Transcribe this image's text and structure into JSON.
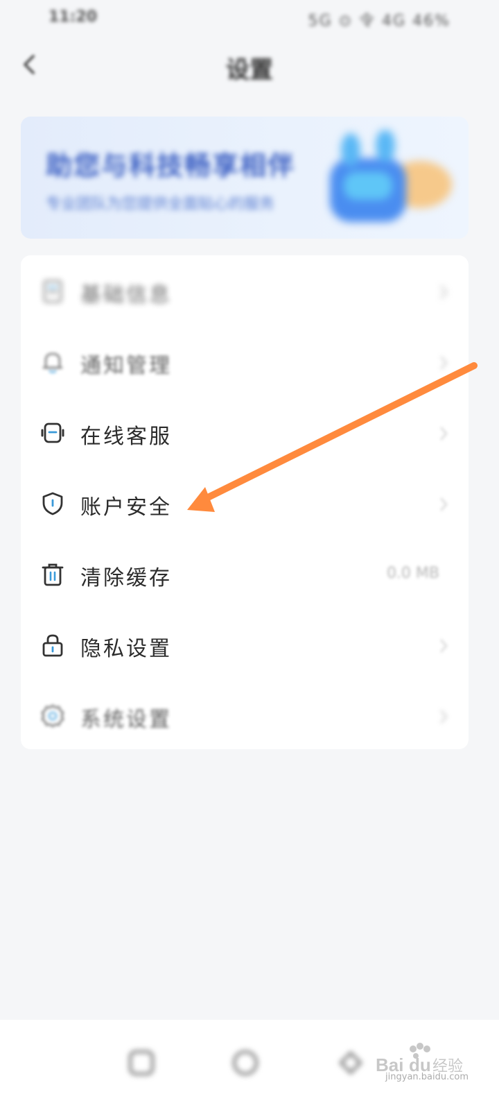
{
  "status_bar": {
    "time": "11:20",
    "icons": "5G ⊙ 令 4G 46%"
  },
  "nav": {
    "title": "设置"
  },
  "banner": {
    "title": "助您与科技畅享相伴",
    "subtitle": "专业团队为您提供全面贴心的服务"
  },
  "menu": {
    "items": [
      {
        "label": "基础信息",
        "icon": "document-icon"
      },
      {
        "label": "通知管理",
        "icon": "bell-icon"
      },
      {
        "label": "在线客服",
        "icon": "headset-icon"
      },
      {
        "label": "账户安全",
        "icon": "shield-icon"
      },
      {
        "label": "清除缓存",
        "icon": "trash-icon",
        "value": "0.0 MB"
      },
      {
        "label": "隐私设置",
        "icon": "lock-icon"
      },
      {
        "label": "系统设置",
        "icon": "gear-icon"
      }
    ]
  },
  "bottom_nav": {
    "items": [
      "home-icon",
      "compass-icon",
      "profile-icon"
    ]
  },
  "watermark": {
    "brand": "Baidu经验",
    "url": "jingyan.baidu.com"
  },
  "colors": {
    "accent": "#3a9ad9",
    "annotation_arrow": "#ff8a3d",
    "banner_text": "#3a5ec2"
  }
}
